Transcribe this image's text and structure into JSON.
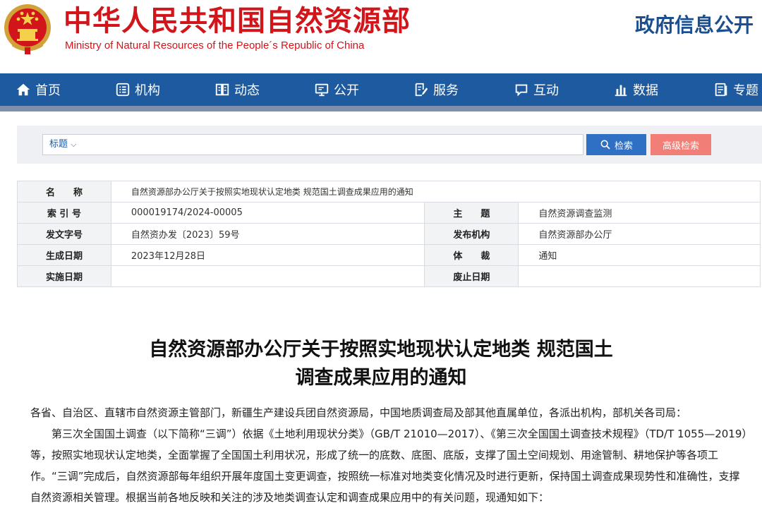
{
  "header": {
    "site_name_cn": "中华人民共和国自然资源部",
    "site_name_en": "Ministry of Natural Resources of the People´s Republic of China",
    "right_title": "政府信息公开"
  },
  "nav": {
    "items": [
      {
        "label": "首页",
        "icon": "home-icon"
      },
      {
        "label": "机构",
        "icon": "org-icon"
      },
      {
        "label": "动态",
        "icon": "news-icon"
      },
      {
        "label": "公开",
        "icon": "screen-icon"
      },
      {
        "label": "服务",
        "icon": "service-icon"
      },
      {
        "label": "互动",
        "icon": "chat-icon"
      },
      {
        "label": "数据",
        "icon": "chart-icon"
      },
      {
        "label": "专题",
        "icon": "topic-icon"
      }
    ]
  },
  "search": {
    "type_label": "标题",
    "search_button": "检索",
    "advanced_button": "高级检索"
  },
  "info": {
    "name_label": "名　　称",
    "name_value": "自然资源部办公厅关于按照实地现状认定地类 规范国土调查成果应用的通知",
    "index_label": "索 引 号",
    "index_value": "000019174/2024-00005",
    "subject_label": "主　　题",
    "subject_value": "自然资源调查监测",
    "doc_no_label": "发文字号",
    "doc_no_value": "自然资办发〔2023〕59号",
    "publisher_label": "发布机构",
    "publisher_value": "自然资源部办公厅",
    "created_label": "生成日期",
    "created_value": "2023年12月28日",
    "genre_label": "体　　裁",
    "genre_value": "通知",
    "effective_label": "实施日期",
    "effective_value": "",
    "abolish_label": "废止日期",
    "abolish_value": ""
  },
  "article": {
    "title_line1": "自然资源部办公厅关于按照实地现状认定地类 规范国土",
    "title_line2": "调查成果应用的通知",
    "addressee": "各省、自治区、直辖市自然资源主管部门，新疆生产建设兵团自然资源局，中国地质调查局及部其他直属单位，各派出机构，部机关各司局：",
    "paragraph1": "第三次全国国土调查（以下简称“三调”）依据《土地利用现状分类》（GB/T 21010—2017）、《第三次全国国土调查技术规程》（TD/T 1055—2019）等，按照实地现状认定地类，全面掌握了全国国土利用状况，形成了统一的底数、底图、底版，支撑了国土空间规划、用途管制、耕地保护等各项工作。“三调”完成后，自然资源部每年组织开展年度国土变更调查，按照统一标准对地类变化情况及时进行更新，保持国土调查成果现势性和准确性，支撑自然资源相关管理。根据当前各地反映和关注的涉及地类调查认定和调查成果应用中的有关问题，现通知如下："
  },
  "colors": {
    "brand_red": "#d2151b",
    "nav_blue": "#1e5aa0",
    "header_blue": "#1b4f8f",
    "search_blue": "#2f6fc4",
    "advanced_red": "#f27f77"
  }
}
